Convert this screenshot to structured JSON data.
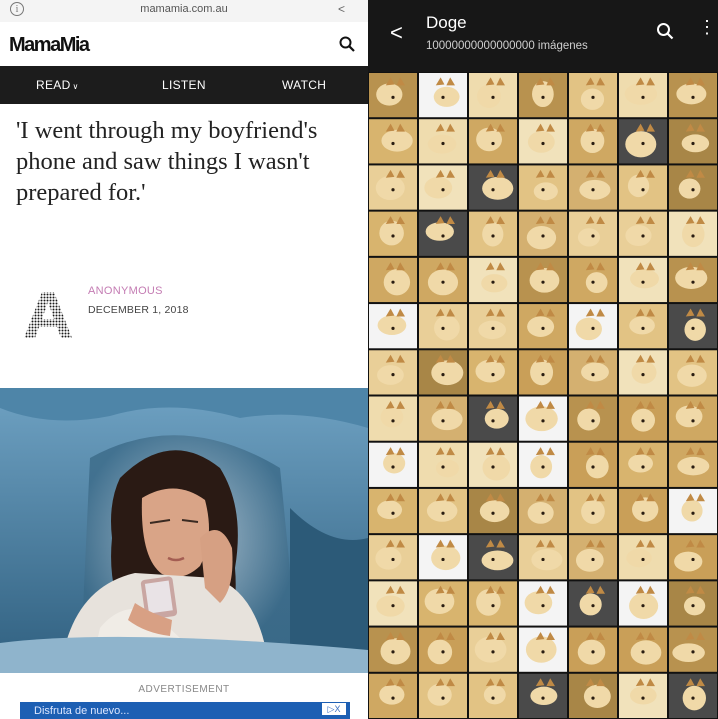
{
  "left": {
    "browser": {
      "url": "mamamia.com.au"
    },
    "site": {
      "logo": "MamaMia"
    },
    "nav": {
      "read": "READ",
      "listen": "LISTEN",
      "watch": "WATCH"
    },
    "article": {
      "headline": "'I went through my boyfriend's phone and saw things I wasn't prepared for.'",
      "author": "ANONYMOUS",
      "date": "DECEMBER 1, 2018"
    },
    "advertisement": {
      "label": "ADVERTISEMENT",
      "banner_text": "Disfruta de nuevo...",
      "ad_badge": "▷X"
    }
  },
  "gallery": {
    "title": "Doge",
    "count": "10000000000000000 imágenes",
    "accent": "#e8c37c"
  }
}
